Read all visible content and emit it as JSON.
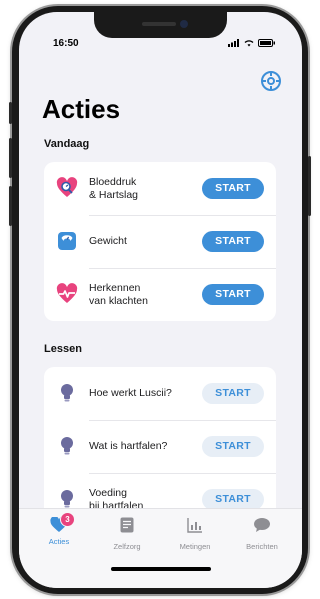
{
  "status_bar": {
    "time": "16:50"
  },
  "header": {
    "title": "Acties"
  },
  "sections": {
    "today": {
      "label": "Vandaag",
      "items": [
        {
          "label_line1": "Bloeddruk",
          "label_line2": "& Hartslag",
          "action": "START",
          "icon": "heart-pulse-icon"
        },
        {
          "label_line1": "Gewicht",
          "label_line2": "",
          "action": "START",
          "icon": "scale-icon"
        },
        {
          "label_line1": "Herkennen",
          "label_line2": "van klachten",
          "action": "START",
          "icon": "heart-monitor-icon"
        }
      ]
    },
    "lessons": {
      "label": "Lessen",
      "items": [
        {
          "label_line1": "Hoe werkt Luscii?",
          "label_line2": "",
          "action": "START",
          "icon": "lightbulb-icon"
        },
        {
          "label_line1": "Wat is hartfalen?",
          "label_line2": "",
          "action": "START",
          "icon": "lightbulb-icon"
        },
        {
          "label_line1": "Voeding",
          "label_line2": "bij hartfalen",
          "action": "START",
          "icon": "lightbulb-icon"
        }
      ]
    }
  },
  "tabbar": {
    "tabs": [
      {
        "label": "Acties",
        "icon": "heart-icon",
        "active": true,
        "badge": "3"
      },
      {
        "label": "Zelfzorg",
        "icon": "document-icon",
        "active": false
      },
      {
        "label": "Metingen",
        "icon": "bar-chart-icon",
        "active": false
      },
      {
        "label": "Berichten",
        "icon": "chat-bubble-icon",
        "active": false
      }
    ]
  },
  "colors": {
    "accent": "#3d8fd8",
    "accent_light": "#e7eef6",
    "heart_pink": "#e8437e",
    "background": "#f2f2f7",
    "inactive": "#8e8e93"
  }
}
